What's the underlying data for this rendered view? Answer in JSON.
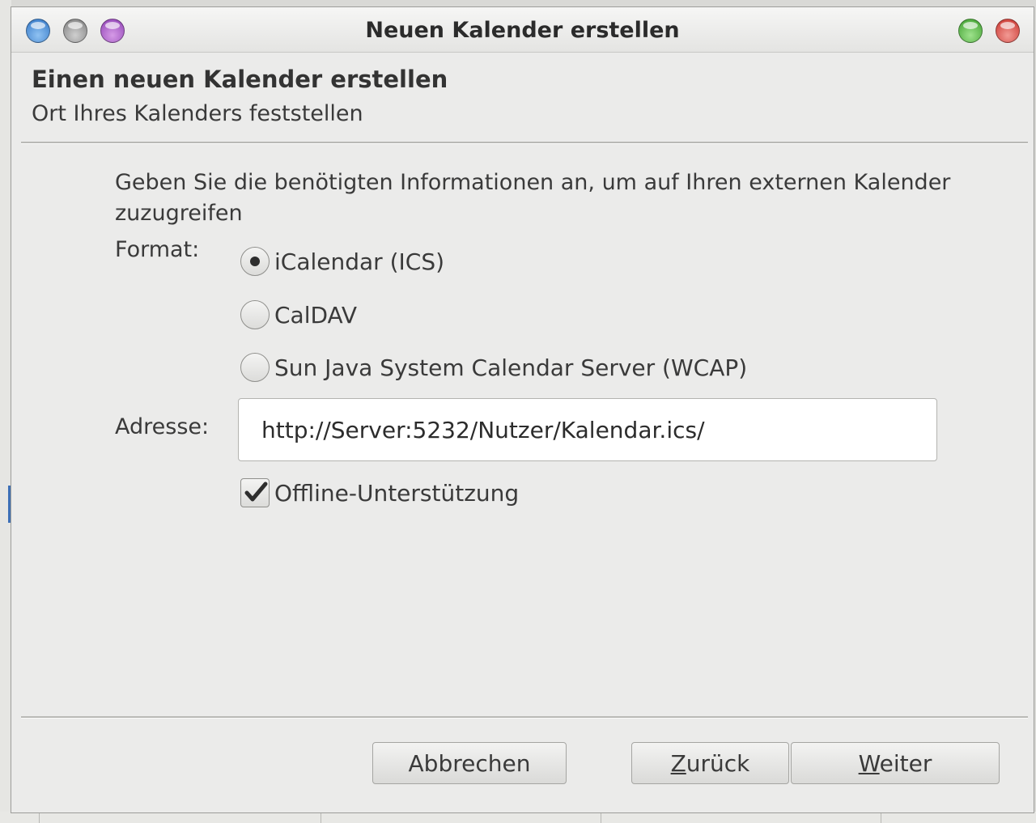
{
  "window": {
    "title": "Neuen Kalender erstellen"
  },
  "header": {
    "title": "Einen neuen Kalender erstellen",
    "subtitle": "Ort Ihres Kalenders feststellen"
  },
  "intro": "Geben Sie die benötigten Informationen an, um auf Ihren externen Kalender zuzugreifen",
  "format": {
    "label": "Format:",
    "options": [
      {
        "label": "iCalendar (ICS)",
        "selected": true
      },
      {
        "label": "CalDAV",
        "selected": false
      },
      {
        "label": "Sun Java System Calendar Server (WCAP)",
        "selected": false
      }
    ]
  },
  "address": {
    "label": "Adresse:",
    "value": "http://Server:5232/Nutzer/Kalendar.ics/"
  },
  "offline": {
    "label": "Offline-Unterstützung",
    "checked": true
  },
  "buttons": {
    "cancel": "Abbrechen",
    "back_accel": "Z",
    "back_rest": "urück",
    "next_accel": "W",
    "next_rest": "eiter"
  }
}
